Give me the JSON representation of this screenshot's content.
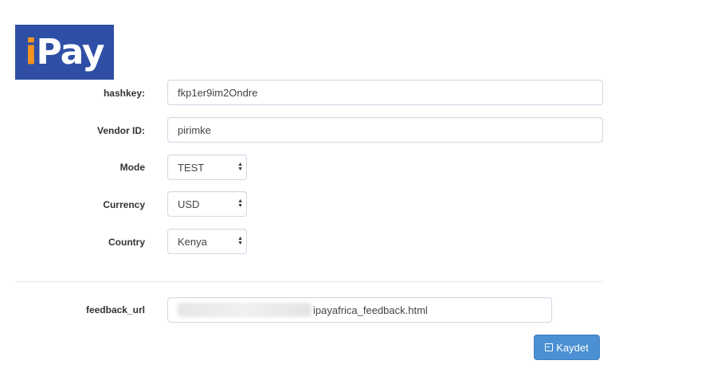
{
  "logo": {
    "text_i": "i",
    "text_rest": "Pay"
  },
  "form": {
    "hashkey": {
      "label": "hashkey:",
      "value": "fkp1er9im2Ondre"
    },
    "vendor_id": {
      "label": "Vendor ID:",
      "value": "pirimke"
    },
    "mode": {
      "label": "Mode",
      "value": "TEST"
    },
    "currency": {
      "label": "Currency",
      "value": "USD"
    },
    "country": {
      "label": "Country",
      "value": "Kenya"
    },
    "feedback_url": {
      "label": "feedback_url",
      "value_visible_suffix": "ipayafrica_feedback.html"
    }
  },
  "actions": {
    "save_label": "Kaydet",
    "save_icon": "save-icon"
  },
  "colors": {
    "logo_bg": "#2e4fa5",
    "logo_accent": "#f7941d",
    "button_bg": "#4a90d2",
    "input_border": "#cfd9e6"
  }
}
